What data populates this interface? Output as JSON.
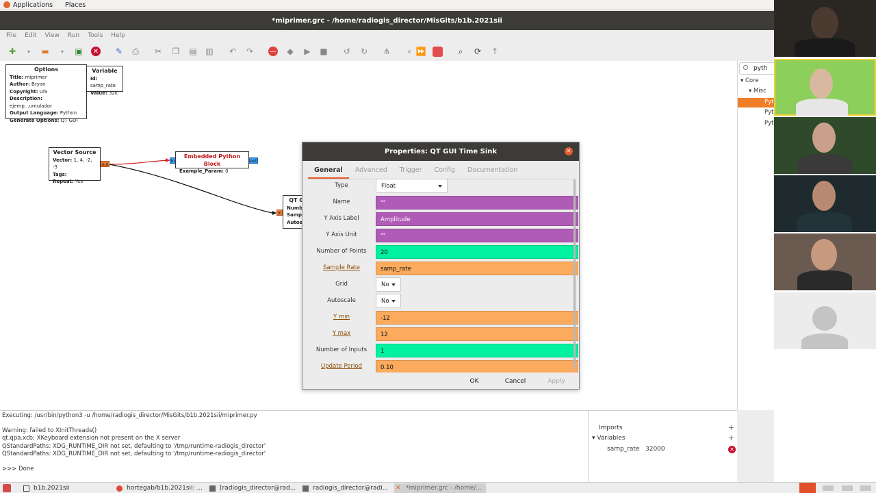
{
  "topbar": {
    "applications": "Applications",
    "places": "Places"
  },
  "window_title": "*miprimer.grc - /home/radiogis_director/MisGits/b1b.2021sii",
  "menubar": [
    "File",
    "Edit",
    "View",
    "Run",
    "Tools",
    "Help"
  ],
  "canvas": {
    "options_block": {
      "title": "Options",
      "lines": [
        {
          "key": "Title:",
          "value": "miprimer"
        },
        {
          "key": "Author:",
          "value": "Bryan"
        },
        {
          "key": "Copyright:",
          "value": "UIS"
        },
        {
          "key": "Description:",
          "value": "ejemp...umulador"
        },
        {
          "key": "Output Language:",
          "value": "Python"
        },
        {
          "key": "Generate Options:",
          "value": "QT GUI"
        }
      ]
    },
    "variable_block": {
      "title": "Variable",
      "lines": [
        {
          "key": "Id:",
          "value": "samp_rate"
        },
        {
          "key": "Value:",
          "value": "32k"
        }
      ]
    },
    "vector_source": {
      "title": "Vector Source",
      "lines": [
        {
          "key": "Vector:",
          "value": "1, 4, -2, -3"
        },
        {
          "key": "Tags:",
          "value": ""
        },
        {
          "key": "Repeat:",
          "value": "Yes"
        }
      ],
      "out_port": "out"
    },
    "embedded_python": {
      "title": "Embedded Python Block",
      "lines": [
        {
          "key": "Example_Param:",
          "value": "0"
        }
      ],
      "in_port": "in",
      "out_port": "out"
    },
    "qt_sink_partial": {
      "title": "QT G",
      "lines": [
        "Numb",
        "Samp",
        "Autos"
      ],
      "in_port": "in"
    }
  },
  "dialog": {
    "title": "Properties: QT GUI Time Sink",
    "tabs": [
      "General",
      "Advanced",
      "Trigger",
      "Config",
      "Documentation"
    ],
    "rows": [
      {
        "label": "Type",
        "value": "Float",
        "kind": "select"
      },
      {
        "label": "Name",
        "value": "\"\"",
        "kind": "purple"
      },
      {
        "label": "Y Axis Label",
        "value": "Amplitude",
        "kind": "purple"
      },
      {
        "label": "Y Axis Unit",
        "value": "\"\"",
        "kind": "purple"
      },
      {
        "label": "Number of Points",
        "value": "20",
        "kind": "green"
      },
      {
        "label": "Sample Rate",
        "value": "samp_rate",
        "kind": "orange",
        "link": true
      },
      {
        "label": "Grid",
        "value": "No",
        "kind": "select"
      },
      {
        "label": "Autoscale",
        "value": "No",
        "kind": "select"
      },
      {
        "label": "Y min",
        "value": "-12",
        "kind": "orange",
        "link": true
      },
      {
        "label": "Y max",
        "value": "12",
        "kind": "orange",
        "link": true
      },
      {
        "label": "Number of Inputs",
        "value": "1",
        "kind": "green"
      },
      {
        "label": "Update Period",
        "value": "0.10",
        "kind": "orange",
        "link": true
      }
    ],
    "buttons": {
      "ok": "OK",
      "cancel": "Cancel",
      "apply": "Apply"
    }
  },
  "block_tree": {
    "search": "pyth",
    "items": [
      "Core",
      "Misc",
      "Pyt",
      "Pyt",
      "Pyt"
    ]
  },
  "console": [
    "Executing: /usr/bin/python3 -u /home/radiogis_director/MisGits/b1b.2021sii/miprimer.py",
    "",
    "Warning: failed to XInitThreads()",
    "qt.qpa.xcb: XKeyboard extension not present on the X server",
    "QStandardPaths: XDG_RUNTIME_DIR not set, defaulting to '/tmp/runtime-radiogis_director'",
    "QStandardPaths: XDG_RUNTIME_DIR not set, defaulting to '/tmp/runtime-radiogis_director'",
    "",
    ">>> Done"
  ],
  "variables_panel": {
    "imports": "Imports",
    "variables": "Variables",
    "var_name": "samp_rate",
    "var_value": "32000"
  },
  "taskbar": [
    "b1b.2021sii",
    "hortegab/b1b.2021sii: ...",
    "[radiogis_director@rad...",
    "radiogis_director@radi...",
    "*miprimer.grc - /home/..."
  ],
  "colors": {
    "accent": "#e45d2a",
    "purple_field": "#b05cb7",
    "green_field": "#00f19f",
    "orange_field": "#fcaa5d"
  }
}
